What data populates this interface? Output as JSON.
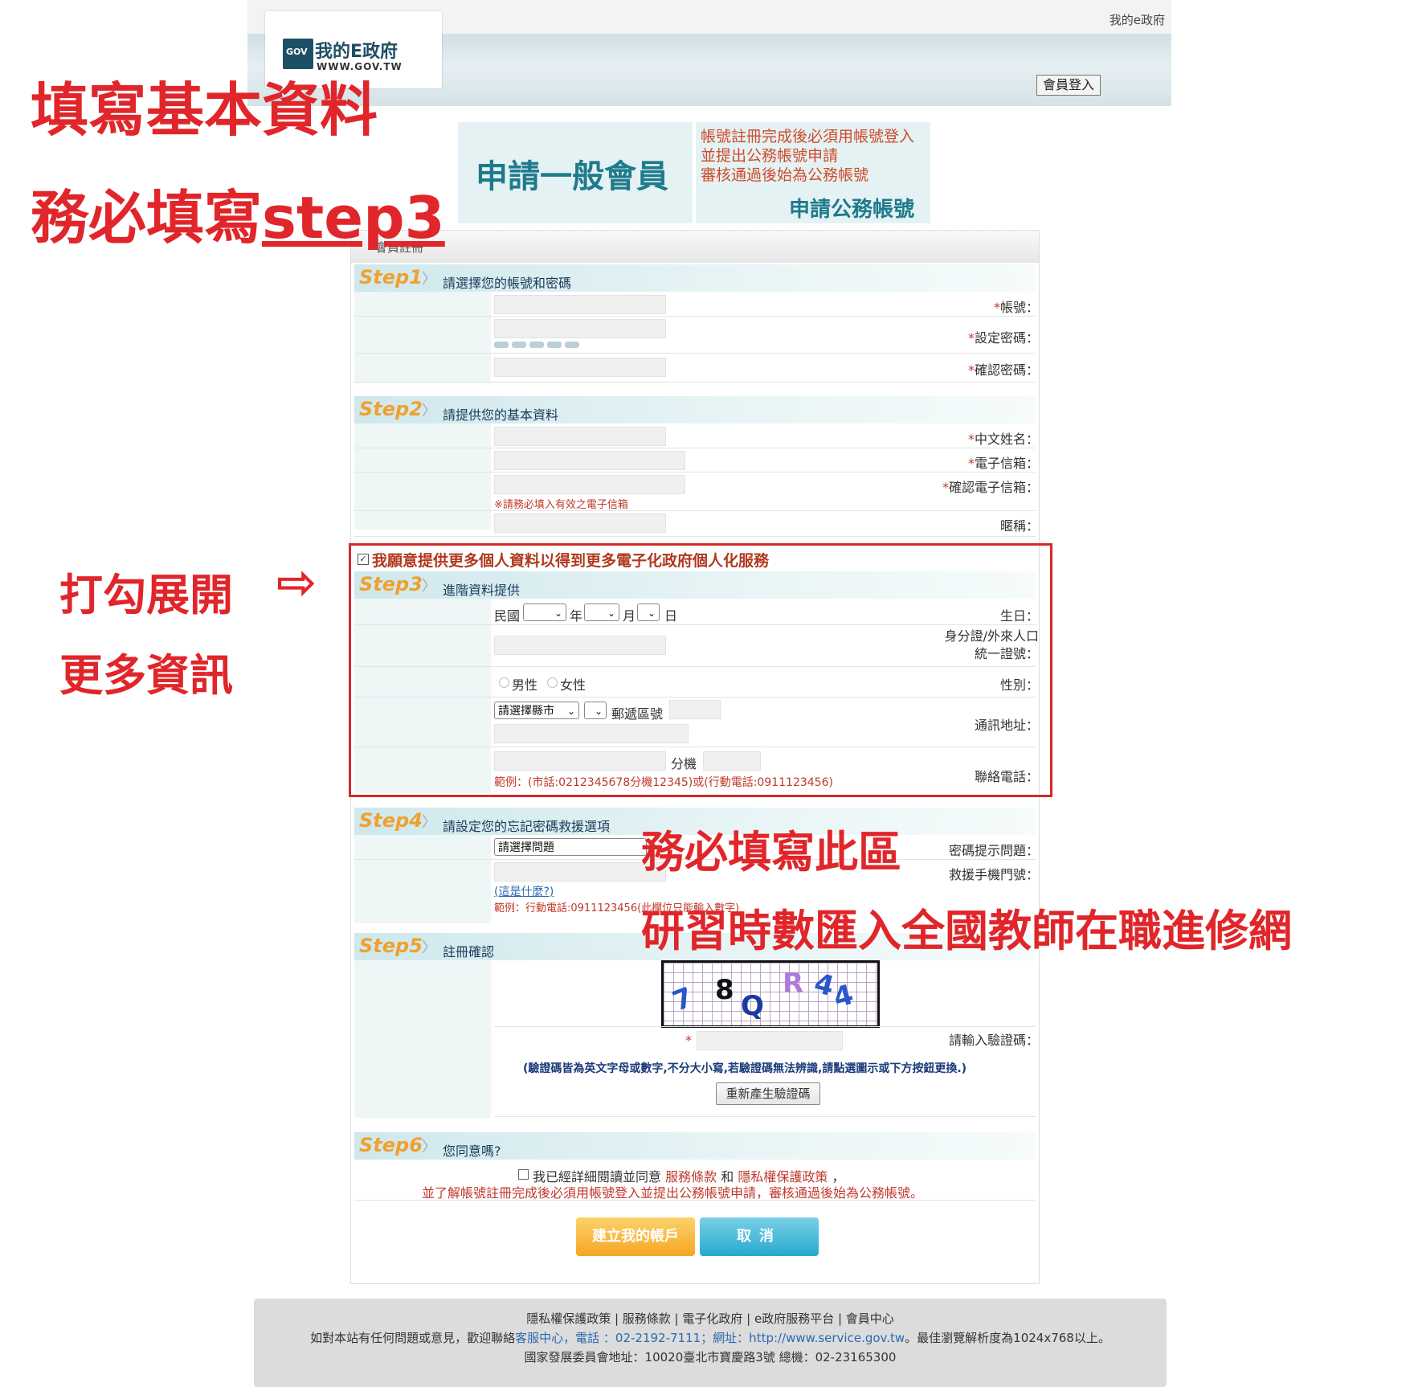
{
  "header": {
    "top_link": "我的e政府",
    "logo_badge": "GOV",
    "logo_title": "我的E政府",
    "logo_url": "WWW.GOV.TW",
    "login_button": "會員登入"
  },
  "tabs": {
    "general": "申請一般會員",
    "official_notes": [
      "帳號註冊完成後必須用帳號登入",
      "並提出公務帳號申請",
      "審核通過後始為公務帳號"
    ],
    "official": "申請公務帳號"
  },
  "panel_title": "會員註冊",
  "step1": {
    "num": "Step1",
    "title": "請選擇您的帳號和密碼",
    "account": "帳號",
    "password": "設定密碼",
    "confirm_password": "確認密碼"
  },
  "step2": {
    "num": "Step2",
    "title": "請提供您的基本資料",
    "name": "中文姓名",
    "email": "電子信箱",
    "confirm_email": "確認電子信箱",
    "email_note": "※請務必填入有效之電子信箱",
    "nickname": "暱稱"
  },
  "optin_label": "我願意提供更多個人資料以得到更多電子化政府個人化服務",
  "step3": {
    "num": "Step3",
    "title": "進階資料提供",
    "birthday": "生日",
    "era": "民國",
    "year": "年",
    "month": "月",
    "day": "日",
    "id_line1": "身分證/外來人口",
    "id_line2": "統一證號",
    "gender": "性別",
    "male": "男性",
    "female": "女性",
    "address": "通訊地址",
    "county_select": "請選擇縣市",
    "postal": "郵遞區號",
    "phone": "聯絡電話",
    "ext": "分機",
    "phone_example": "範例：(市話:0212345678分機12345)或(行動電話:0911123456)"
  },
  "step4": {
    "num": "Step4",
    "title": "請設定您的忘記密碼救援選項",
    "hint_q": "密碼提示問題",
    "hint_select": "請選擇問題",
    "rescue_phone": "救援手機門號",
    "what_link": "(這是什麼?)",
    "rescue_example": "範例：行動電話:0911123456(此欄位只能輸入數字)"
  },
  "step5": {
    "num": "Step5",
    "title": "註冊確認",
    "captcha_label": "請輸入驗證碼",
    "captcha_chars": [
      "7",
      "8",
      "Q",
      "R",
      "4",
      "4"
    ],
    "captcha_note": "(驗證碼皆為英文字母或數字,不分大小寫,若驗證碼無法辨識,請點選圖示或下方按鈕更換.)",
    "regen_button": "重新產生驗證碼"
  },
  "step6": {
    "num": "Step6",
    "title": "您同意嗎?",
    "agree_text": "我已經詳細閱讀並同意",
    "terms": "服務條款",
    "and": "和",
    "privacy": "隱私權保護政策",
    "comma": "，",
    "agree_line2": "並了解帳號註冊完成後必須用帳號登入並提出公務帳號申請，審核通過後始為公務帳號。"
  },
  "buttons": {
    "create": "建立我的帳戶",
    "cancel": "取消"
  },
  "footer": {
    "links": "隱私權保護政策 | 服務條款 | 電子化政府 | e政府服務平台 | 會員中心",
    "contact_pre": "如對本站有任何問題或意見，歡迎聯絡",
    "contact_link": "客服中心，電話 ：02-2192-7111；網址：http://www.service.gov.tw",
    "contact_post": "。最佳瀏覽解析度為1024x768以上。",
    "address": "國家發展委員會地址：10020臺北市寶慶路3號 總機：02-23165300"
  },
  "annotations": {
    "fill_basic": "填寫基本資料",
    "must_step3_pre": "務必填寫",
    "must_step3_step": "step3",
    "check_expand": "打勾展開",
    "arrow": "⇨",
    "more_info": "更多資訊",
    "must_area": "務必填寫此區",
    "hours_import": "研習時數匯入全國教師在職進修網"
  },
  "colors": {
    "annotation_red": "#e0262a",
    "teal": "#1f7a8c",
    "step_orange": "#f0a030"
  }
}
